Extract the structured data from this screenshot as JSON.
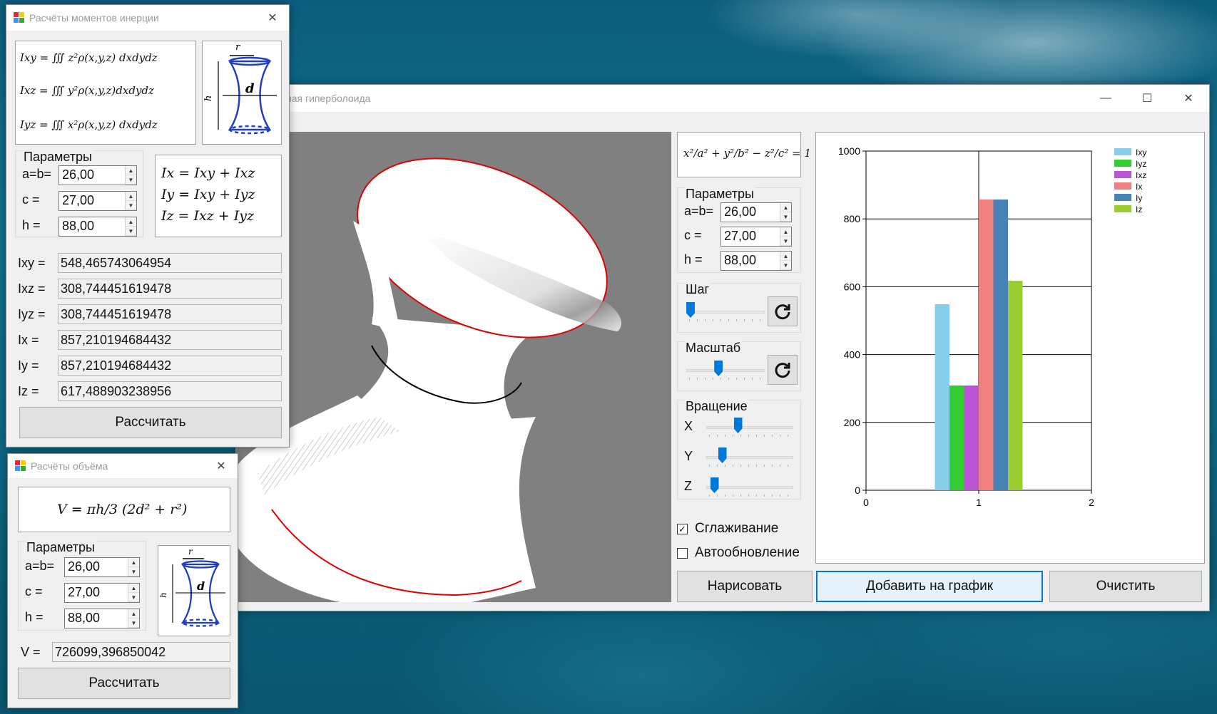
{
  "main": {
    "title": "ная гиперболоида",
    "equation": "x²/a² + y²/b² − z²/c² = 1",
    "params_label": "Параметры",
    "ab_label": "a=b=",
    "ab_value": "26,00",
    "c_label": "c =",
    "c_value": "27,00",
    "h_label": "h =",
    "h_value": "88,00",
    "step_label": "Шаг",
    "scale_label": "Масштаб",
    "rotation_label": "Вращение",
    "rot_x_label": "X",
    "rot_y_label": "Y",
    "rot_z_label": "Z",
    "smoothing_label": "Сглаживание",
    "autoupdate_label": "Автообновление",
    "draw_button": "Нарисовать",
    "add_button": "Добавить на график",
    "clear_button": "Очистить",
    "step_level": 0.0,
    "scale_level": 0.4,
    "rot_x_level": 0.35,
    "rot_y_level": 0.15,
    "rot_z_level": 0.05,
    "smoothing_checked": true,
    "autoupdate_checked": false
  },
  "inertia": {
    "title": "Расчёты моментов инерции",
    "formula_ixy": "Ixy = ∭ z²ρ(x,y,z) dxdydz",
    "formula_ixz": "Ixz = ∭ y²ρ(x,y,z)dxdydz",
    "formula_iyz": "Iyz = ∭ x²ρ(x,y,z) dxdydz",
    "sum_ix": "Ix = Ixy + Ixz",
    "sum_iy": "Iy = Ixy + Iyz",
    "sum_iz": "Iz = Ixz + Iyz",
    "params_label": "Параметры",
    "ab_label": "a=b=",
    "ab_value": "26,00",
    "c_label": "c =",
    "c_value": "27,00",
    "h_label": "h =",
    "h_value": "88,00",
    "results": [
      {
        "label": "Ixy =",
        "value": "548,465743064954"
      },
      {
        "label": "Ixz =",
        "value": "308,744451619478"
      },
      {
        "label": "Iyz =",
        "value": "308,744451619478"
      },
      {
        "label": "Ix =",
        "value": "857,210194684432"
      },
      {
        "label": "Iy =",
        "value": "857,210194684432"
      },
      {
        "label": "Iz =",
        "value": "617,488903238956"
      }
    ],
    "calc_button": "Рассчитать",
    "diagram_r": "r",
    "diagram_d": "d",
    "diagram_h": "h"
  },
  "volume": {
    "title": "Расчёты объёма",
    "formula": "V = πh/3 (2d² + r²)",
    "params_label": "Параметры",
    "ab_label": "a=b=",
    "ab_value": "26,00",
    "c_label": "c =",
    "c_value": "27,00",
    "h_label": "h =",
    "h_value": "88,00",
    "v_label": "V =",
    "v_value": "726099,396850042",
    "calc_button": "Рассчитать",
    "diagram_r": "r",
    "diagram_d": "d",
    "diagram_h": "h"
  },
  "chart_data": {
    "type": "bar",
    "x_ticks": [
      "0",
      "1",
      "2"
    ],
    "y_ticks": [
      "0",
      "200",
      "400",
      "600",
      "800",
      "1000"
    ],
    "xlim": [
      0,
      2
    ],
    "ylim": [
      0,
      1000
    ],
    "grid": true,
    "legend_position": "top-right",
    "series": [
      {
        "name": "Ixy",
        "value": 548.47,
        "color": "#87ceeb"
      },
      {
        "name": "Iyz",
        "value": 308.74,
        "color": "#32cd32"
      },
      {
        "name": "Ixz",
        "value": 308.74,
        "color": "#ba55d3"
      },
      {
        "name": "Ix",
        "value": 857.21,
        "color": "#f08080"
      },
      {
        "name": "Iy",
        "value": 857.21,
        "color": "#4682b4"
      },
      {
        "name": "Iz",
        "value": 617.49,
        "color": "#9acd32"
      }
    ],
    "bar_center_x": 1.0
  },
  "colors": {
    "accent": "#0078d7",
    "viewport_bg": "#808080",
    "rim": "#e00000"
  }
}
